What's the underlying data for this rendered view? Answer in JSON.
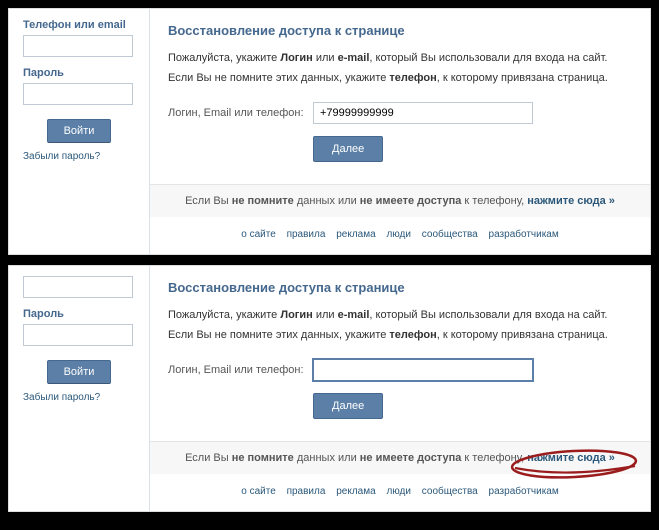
{
  "panels": [
    {
      "sidebar": {
        "login_label": "Телефон или email",
        "password_label": "Пароль",
        "login_button": "Войти",
        "forgot_link": "Забыли пароль?"
      },
      "main": {
        "title": "Восстановление доступа к странице",
        "instruction_line1_pre": "Пожалуйста, укажите ",
        "instruction_line1_b1": "Логин",
        "instruction_line1_mid": " или ",
        "instruction_line1_b2": "e-mail",
        "instruction_line1_post": ", который Вы использовали для входа на сайт.",
        "instruction_line2_pre": "Если Вы не помните этих данных, укажите ",
        "instruction_line2_b": "телефон",
        "instruction_line2_post": ", к которому привязана страница.",
        "field_label": "Логин, Email или телефон:",
        "field_value": "+79999999999",
        "next_button": "Далее"
      },
      "footer": {
        "text_pre": "Если Вы ",
        "text_b1": "не помните",
        "text_mid1": " данных или ",
        "text_b2": "не имеете доступа",
        "text_mid2": " к телефону, ",
        "text_link": "нажмите сюда »",
        "circled": false
      },
      "show_login_label": true
    },
    {
      "sidebar": {
        "login_label": "",
        "password_label": "Пароль",
        "login_button": "Войти",
        "forgot_link": "Забыли пароль?"
      },
      "main": {
        "title": "Восстановление доступа к странице",
        "instruction_line1_pre": "Пожалуйста, укажите ",
        "instruction_line1_b1": "Логин",
        "instruction_line1_mid": " или ",
        "instruction_line1_b2": "e-mail",
        "instruction_line1_post": ", который Вы использовали для входа на сайт.",
        "instruction_line2_pre": "Если Вы не помните этих данных, укажите ",
        "instruction_line2_b": "телефон",
        "instruction_line2_post": ", к которому привязана страница.",
        "field_label": "Логин, Email или телефон:",
        "field_value": "",
        "next_button": "Далее"
      },
      "footer": {
        "text_pre": "Если Вы ",
        "text_b1": "не помните",
        "text_mid1": " данных или ",
        "text_b2": "не имеете доступа",
        "text_mid2": " к телефону, ",
        "text_link": "нажмите сюда »",
        "circled": true
      },
      "show_login_label": false
    }
  ],
  "footer_links": [
    "о сайте",
    "правила",
    "реклама",
    "люди",
    "сообщества",
    "разработчикам"
  ]
}
